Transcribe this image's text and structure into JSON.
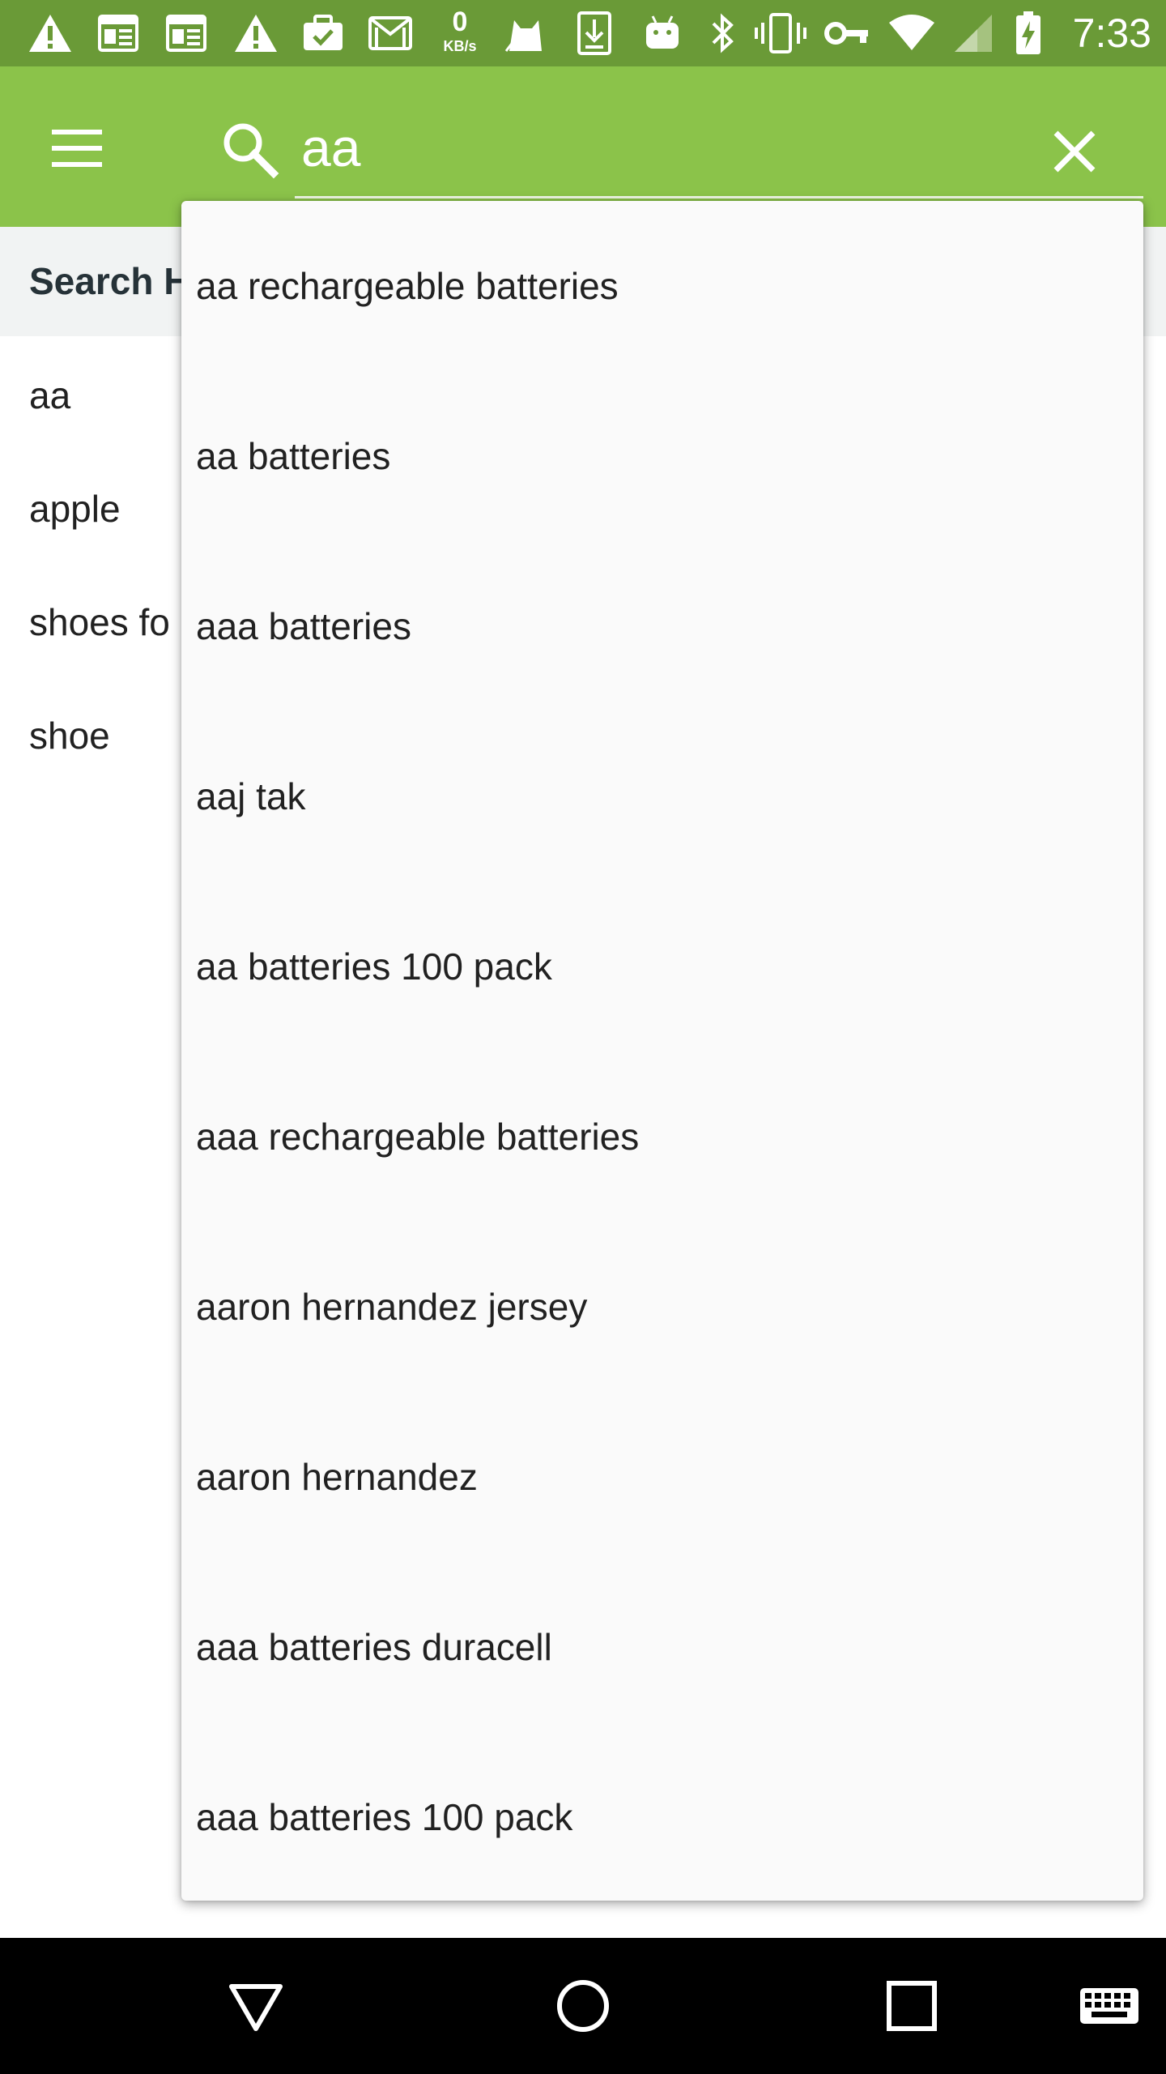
{
  "status_bar": {
    "icons": [
      "warning-icon",
      "news-icon",
      "news-icon",
      "warning-icon",
      "briefcase-check-icon",
      "gmail-icon",
      "cat-icon",
      "download-icon",
      "android-icon",
      "bluetooth-icon",
      "vibrate-icon",
      "key-icon",
      "wifi-icon",
      "signal-icon",
      "battery-charging-icon"
    ],
    "speed_value": "0",
    "speed_unit": "KB/s",
    "time": "7:33"
  },
  "app_bar": {
    "search_query": "aa",
    "background_color": "#8bc34a",
    "status_bar_color": "#6a9a37"
  },
  "history": {
    "title": "Search H",
    "items": [
      "aa",
      "apple",
      "shoes fo",
      "shoe"
    ]
  },
  "suggestions": [
    "aa rechargeable batteries",
    "aa batteries",
    "aaa batteries",
    "aaj tak",
    "aa batteries 100 pack",
    "aaa rechargeable batteries",
    "aaron hernandez jersey",
    "aaron hernandez",
    "aaa batteries duracell",
    "aaa batteries 100 pack"
  ],
  "nav_bar": {
    "icons": [
      "back-icon",
      "home-icon",
      "recents-icon",
      "keyboard-icon"
    ]
  }
}
